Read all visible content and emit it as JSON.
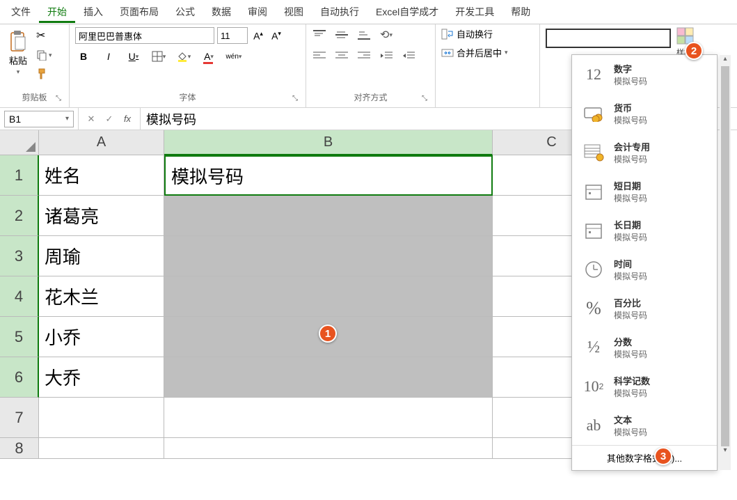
{
  "menu": {
    "items": [
      "文件",
      "开始",
      "插入",
      "页面布局",
      "公式",
      "数据",
      "审阅",
      "视图",
      "自动执行",
      "Excel自学成才",
      "开发工具",
      "帮助"
    ],
    "active_index": 1
  },
  "ribbon": {
    "clipboard": {
      "label": "剪贴板",
      "paste": "粘贴"
    },
    "font": {
      "label": "字体",
      "name": "阿里巴巴普惠体",
      "size": "11",
      "bold": "B",
      "italic": "I",
      "underline": "U",
      "wen": "wén"
    },
    "align": {
      "label": "对齐方式"
    },
    "wrap": {
      "label": "自动换行"
    },
    "merge": {
      "label": "合并后居中"
    },
    "styles_suffix": "样格"
  },
  "name_box": "B1",
  "formula_value": "模拟号码",
  "columns": [
    "A",
    "B",
    "C"
  ],
  "rows": [
    {
      "num": "1",
      "A": "姓名",
      "B": "模拟号码"
    },
    {
      "num": "2",
      "A": "诸葛亮",
      "B": ""
    },
    {
      "num": "3",
      "A": "周瑜",
      "B": ""
    },
    {
      "num": "4",
      "A": "花木兰",
      "B": ""
    },
    {
      "num": "5",
      "A": "小乔",
      "B": ""
    },
    {
      "num": "6",
      "A": "大乔",
      "B": ""
    },
    {
      "num": "7",
      "A": "",
      "B": ""
    },
    {
      "num": "8",
      "A": "",
      "B": ""
    }
  ],
  "format_dropdown": {
    "options": [
      {
        "icon": "12",
        "title": "数字",
        "sub": "模拟号码"
      },
      {
        "icon": "currency",
        "title": "货币",
        "sub": "模拟号码"
      },
      {
        "icon": "accounting",
        "title": "会计专用",
        "sub": "模拟号码"
      },
      {
        "icon": "shortdate",
        "title": "短日期",
        "sub": "模拟号码"
      },
      {
        "icon": "longdate",
        "title": "长日期",
        "sub": "模拟号码"
      },
      {
        "icon": "time",
        "title": "时间",
        "sub": "模拟号码"
      },
      {
        "icon": "percent",
        "title": "百分比",
        "sub": "模拟号码"
      },
      {
        "icon": "fraction",
        "title": "分数",
        "sub": "模拟号码"
      },
      {
        "icon": "scientific",
        "title": "科学记数",
        "sub": "模拟号码"
      },
      {
        "icon": "text",
        "title": "文本",
        "sub": "模拟号码"
      }
    ],
    "more": "其他数字格式(M)..."
  },
  "callouts": {
    "c1": "1",
    "c2": "2",
    "c3": "3"
  }
}
